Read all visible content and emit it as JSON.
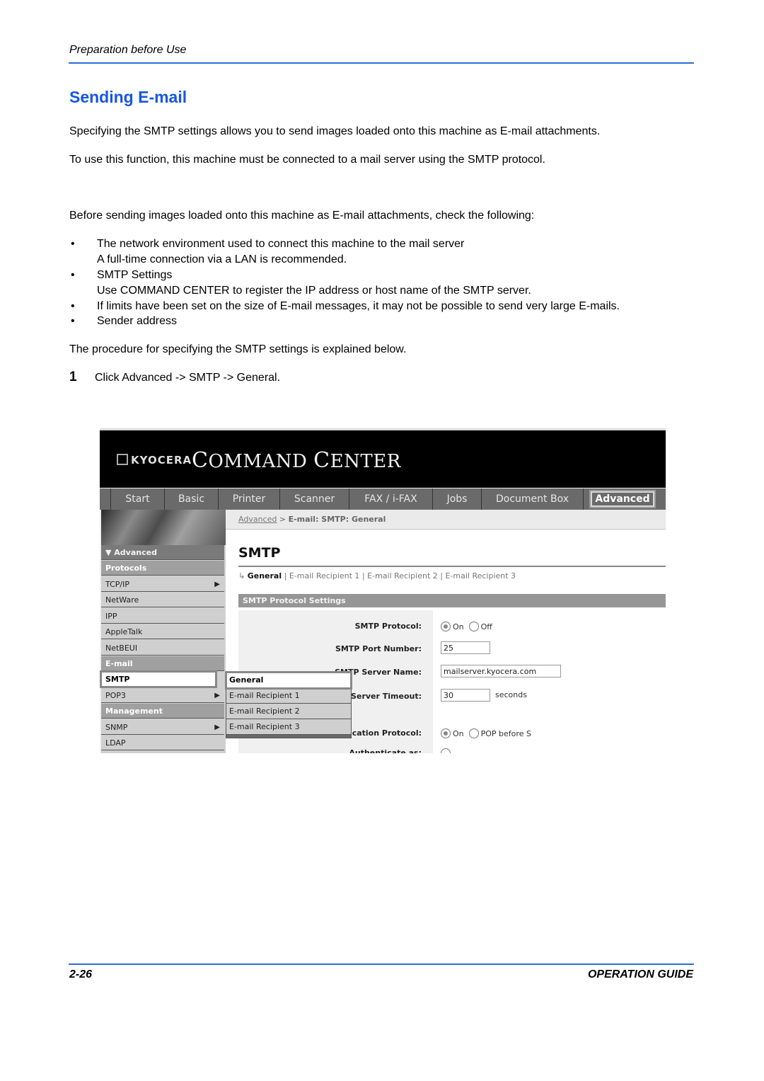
{
  "header": {
    "section": "Preparation before Use"
  },
  "title": "Sending E-mail",
  "intro": [
    "Specifying the SMTP settings allows you to send images loaded onto this machine as E-mail attachments.",
    "To use this function, this machine must be connected to a mail server using the SMTP protocol."
  ],
  "check_intro": "Before sending images loaded onto this machine as E-mail attachments, check the following:",
  "checklist": [
    {
      "main": "The network environment used to connect this machine to the mail server",
      "sub": "A full-time connection via a LAN is recommended."
    },
    {
      "main": "SMTP Settings",
      "sub": "Use COMMAND CENTER to register the IP address or host name of the SMTP server."
    },
    {
      "main": "If limits have been set on the size of E-mail messages, it may not be possible to send very large E-mails.",
      "sub": ""
    },
    {
      "main": "Sender address",
      "sub": ""
    }
  ],
  "procedure_intro": "The procedure for specifying the SMTP settings is explained below.",
  "steps": [
    {
      "number": "1",
      "text": "Click Advanced -> SMTP -> General."
    }
  ],
  "screenshot": {
    "logo": "KYOCERA",
    "app_title_first": "C",
    "app_title_rest1": "OMMAND ",
    "app_title_second": "C",
    "app_title_rest2": "ENTER",
    "nav_tabs": [
      "Start",
      "Basic",
      "Printer",
      "Scanner",
      "FAX / i-FAX",
      "Jobs",
      "Document Box",
      "Advanced"
    ],
    "active_tab": "Advanced",
    "breadcrumb": {
      "link": "Advanced",
      "sep": ">",
      "current": "E-mail: SMTP: General"
    },
    "sidebar": {
      "header": "▼ Advanced",
      "items": [
        {
          "label": "Protocols",
          "type": "group"
        },
        {
          "label": "TCP/IP",
          "arrow": "▶"
        },
        {
          "label": "NetWare"
        },
        {
          "label": "IPP"
        },
        {
          "label": "AppleTalk"
        },
        {
          "label": "NetBEUI"
        },
        {
          "label": "E-mail",
          "type": "group"
        },
        {
          "label": "SMTP",
          "arrow": "▶",
          "selected": true
        },
        {
          "label": "POP3",
          "arrow": "▶"
        },
        {
          "label": "Management",
          "type": "group"
        },
        {
          "label": "SNMP",
          "arrow": "▶"
        },
        {
          "label": "LDAP"
        }
      ]
    },
    "submenu": [
      "General",
      "E-mail Recipient 1",
      "E-mail Recipient 2",
      "E-mail Recipient 3"
    ],
    "page_title": "SMTP",
    "subtabs": {
      "arrow": "↳",
      "current": "General",
      "others": [
        "E-mail Recipient 1",
        "E-mail Recipient 2",
        "E-mail Recipient 3"
      ],
      "sep": "|"
    },
    "section_title": "SMTP Protocol Settings",
    "fields": {
      "protocol": {
        "label": "SMTP Protocol:",
        "opt_on": "On",
        "opt_off": "Off",
        "value": "On"
      },
      "port": {
        "label": "SMTP Port Number:",
        "value": "25"
      },
      "server": {
        "label": "SMTP Server Name:",
        "value": "mailserver.kyocera.com"
      },
      "timeout": {
        "label": "SMTP Server Timeout:",
        "value": "30",
        "unit": "seconds"
      },
      "auth": {
        "label": "Authentication Protocol:",
        "opt_on": "On",
        "opt_pop": "POP before S",
        "value": "On"
      },
      "auth_as": {
        "label": "Authenticate as:"
      }
    }
  },
  "footer": {
    "page": "2-26",
    "guide": "OPERATION GUIDE"
  }
}
